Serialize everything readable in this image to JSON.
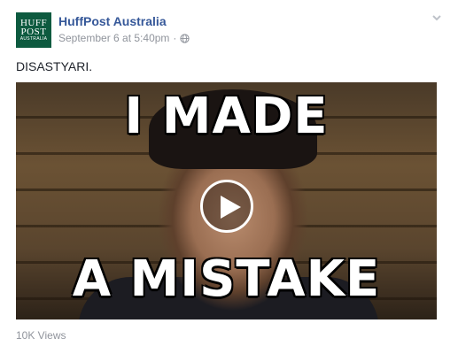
{
  "post": {
    "page_name": "HuffPost Australia",
    "avatar": {
      "line1": "HUFF",
      "line2": "POST",
      "line3": "AUSTRALIA",
      "color": "#0d5a3f"
    },
    "timestamp": "September 6 at 5:40pm",
    "separator": "·",
    "privacy_icon": "globe-icon",
    "menu_icon": "chevron-down-icon",
    "text": "DISASTYARI.",
    "video": {
      "caption_top": "I MADE",
      "caption_bottom": "A MISTAKE",
      "play_icon": "play-icon"
    },
    "views": "10K Views"
  },
  "colors": {
    "link": "#365899",
    "meta": "#90949c",
    "text": "#1d2129"
  }
}
